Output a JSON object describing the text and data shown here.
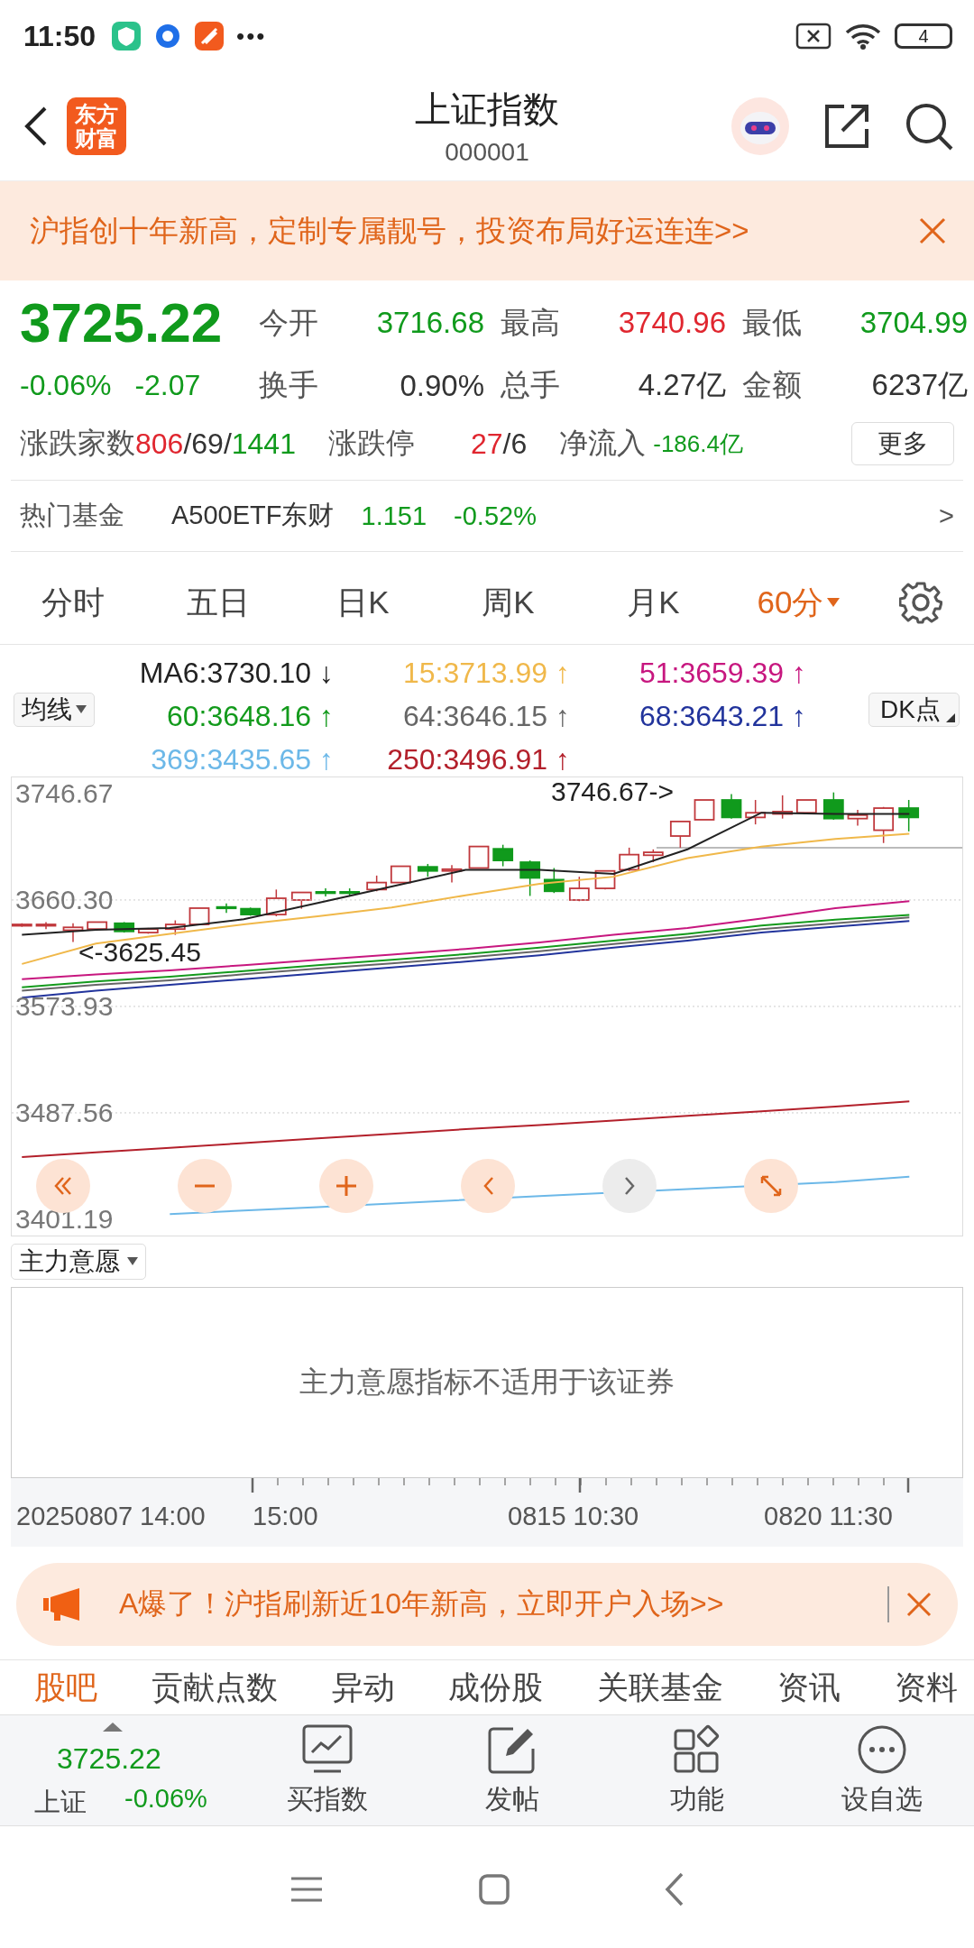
{
  "status_bar": {
    "time": "11:50",
    "more": "•••",
    "battery": "4"
  },
  "header": {
    "logo_text": "东方财富",
    "title": "上证指数",
    "code": "000001"
  },
  "banner": {
    "text": "沪指创十年新高，定制专属靓号，投资布局好运连连>>"
  },
  "quote": {
    "price": "3725.22",
    "change_pct": "-0.06%",
    "change": "-2.07",
    "color": "#109a1c",
    "stats": [
      {
        "label": "今开",
        "value": "3716.68",
        "color": "#109a1c"
      },
      {
        "label": "最高",
        "value": "3740.96",
        "color": "#e0262f"
      },
      {
        "label": "最低",
        "value": "3704.99",
        "color": "#109a1c"
      },
      {
        "label": "换手",
        "value": "0.90%",
        "color": "#333333"
      },
      {
        "label": "总手",
        "value": "4.27亿",
        "color": "#333333"
      },
      {
        "label": "金额",
        "value": "6237亿",
        "color": "#333333"
      }
    ],
    "breadth": {
      "label": "涨跌家数",
      "parts": [
        {
          "text": "806",
          "color": "#e0262f"
        },
        {
          "text": "/69/",
          "color": "#333333"
        },
        {
          "text": "1441",
          "color": "#109a1c"
        }
      ]
    },
    "limit": {
      "label": "涨跌停",
      "parts": [
        {
          "text": "27",
          "color": "#e0262f"
        },
        {
          "text": "/6",
          "color": "#333333"
        }
      ]
    },
    "net_inflow": {
      "label": "净流入",
      "value": "-186.4亿",
      "color": "#109a1c"
    },
    "more_button": "更多"
  },
  "hot_fund": {
    "label": "热门基金",
    "name": "A500ETF东财",
    "price": "1.151",
    "change": "-0.52%",
    "color": "#109a1c",
    "arrow": ">"
  },
  "period_tabs": [
    {
      "label": "分时",
      "selected": false
    },
    {
      "label": "五日",
      "selected": false
    },
    {
      "label": "日K",
      "selected": false
    },
    {
      "label": "周K",
      "selected": false
    },
    {
      "label": "月K",
      "selected": false
    },
    {
      "label": "60分",
      "selected": true
    }
  ],
  "ma_legend": {
    "button": "均线",
    "dk_button": "DK点",
    "items": [
      {
        "value": ":3730.10",
        "arrow": "↓"
      },
      {
        "value": ":3713.99",
        "arrow": "↑"
      },
      {
        "value": ":3659.39",
        "arrow": "↑"
      },
      {
        "value": ":3648.16",
        "arrow": "↑"
      },
      {
        "value": ":3646.15",
        "arrow": "↑"
      },
      {
        "value": ":3643.21",
        "arrow": "↑"
      },
      {
        "value": ":3435.65",
        "arrow": "↑"
      },
      {
        "value": ":3496.91",
        "arrow": "↑"
      }
    ]
  },
  "chart": {
    "chart_data": {
      "type": "line",
      "grid": true,
      "ylim": [
        3388.0,
        3759.8
      ],
      "yticks": [
        {
          "value": 3746.67,
          "label": "3746.67"
        },
        {
          "value": 3660.3,
          "label": "3660.30"
        },
        {
          "value": 3573.93,
          "label": "3573.93"
        },
        {
          "value": 3487.56,
          "label": "3487.56"
        },
        {
          "value": 3401.19,
          "label": "3401.19"
        }
      ],
      "series": [
        {
          "name": "MA6",
          "color": "#222222",
          "values": [
            3632.0,
            3636.2,
            3637.6,
            3644.7,
            3657.9,
            3671.2,
            3684.8,
            3684.8,
            3681.5,
            3701.4,
            3731.1,
            3730.2,
            3730.1
          ]
        },
        {
          "name": "15",
          "color": "#f0b84a",
          "values": [
            3608.4,
            3624.9,
            3632.9,
            3640.5,
            3647.1,
            3654.2,
            3664.1,
            3673.5,
            3679.2,
            3694.3,
            3703.7,
            3709.9,
            3714.0
          ]
        },
        {
          "name": "51",
          "color": "#c7177f",
          "values": [
            3596.1,
            3599.9,
            3603.2,
            3607.4,
            3611.7,
            3615.9,
            3620.6,
            3625.8,
            3632.0,
            3637.6,
            3645.2,
            3653.7,
            3659.4
          ]
        },
        {
          "name": "60",
          "color": "#139a1c",
          "values": [
            3589.5,
            3594.2,
            3598.0,
            3602.7,
            3607.4,
            3611.7,
            3616.4,
            3621.6,
            3627.3,
            3632.9,
            3639.5,
            3644.3,
            3648.2
          ]
        },
        {
          "name": "64",
          "color": "#666666",
          "values": [
            3586.7,
            3591.4,
            3595.2,
            3600.0,
            3604.6,
            3608.9,
            3613.6,
            3618.8,
            3624.5,
            3630.1,
            3636.7,
            3641.5,
            3646.2
          ]
        },
        {
          "name": "68",
          "color": "#22349c",
          "values": [
            3581.0,
            3586.7,
            3591.4,
            3596.1,
            3600.8,
            3605.5,
            3610.3,
            3615.5,
            3621.6,
            3627.3,
            3633.9,
            3638.6,
            3643.2
          ]
        },
        {
          "name": "369",
          "color": "#6cb8e8",
          "values": [
            null,
            null,
            3405.4,
            3408.3,
            3411.1,
            3413.9,
            null,
            3420.0,
            null,
            3425.7,
            null,
            3431.4,
            3435.7
          ]
        },
        {
          "name": "250",
          "color": "#b3202b",
          "values": [
            3451.7,
            3455.5,
            3459.2,
            3463.0,
            3466.8,
            3470.5,
            3474.3,
            3477.6,
            3481.4,
            3485.1,
            3488.9,
            3492.7,
            3496.9
          ]
        }
      ]
    },
    "high_marker": "3746.67->",
    "low_marker": "<-3625.45"
  },
  "indicator": {
    "dropdown": "主力意愿",
    "message": "主力意愿指标不适用于该证券"
  },
  "time_axis": [
    "20250807 14:00",
    "15:00",
    "0815 10:30",
    "0820 11:30"
  ],
  "ad": {
    "text": "A爆了！沪指刷新近10年新高，立即开户入场>>"
  },
  "content_tabs": [
    {
      "label": "股吧",
      "selected": true
    },
    {
      "label": "贡献点数",
      "selected": false
    },
    {
      "label": "异动",
      "selected": false
    },
    {
      "label": "成份股",
      "selected": false
    },
    {
      "label": "关联基金",
      "selected": false
    },
    {
      "label": "资讯",
      "selected": false
    },
    {
      "label": "资料",
      "selected": false
    }
  ],
  "bottom_bar": {
    "index_price": "3725.22",
    "index_name": "上证",
    "index_change": "-0.06%",
    "color": "#109a1c",
    "actions": [
      {
        "label": "买指数",
        "kind": "chart"
      },
      {
        "label": "发帖",
        "kind": "post"
      },
      {
        "label": "功能",
        "kind": "apps"
      },
      {
        "label": "设自选",
        "kind": "more"
      }
    ]
  }
}
